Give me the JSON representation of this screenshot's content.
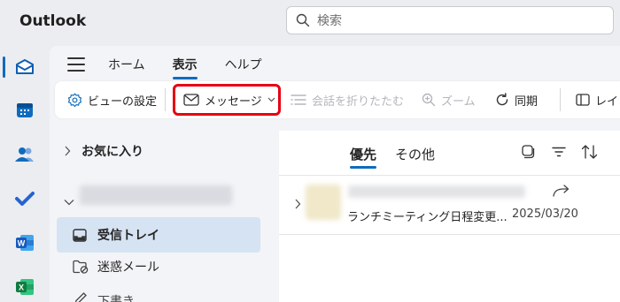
{
  "app": {
    "title": "Outlook"
  },
  "search": {
    "placeholder": "検索"
  },
  "tabs": {
    "home": "ホーム",
    "view": "表示",
    "help": "ヘルプ"
  },
  "ribbon": {
    "view_settings": "ビューの設定",
    "messages": "メッセージ",
    "collapse_conversations": "会話を折りたたむ",
    "zoom": "ズーム",
    "sync": "同期",
    "layout": "レイ"
  },
  "folders": {
    "favorites": "お気に入り",
    "inbox": "受信トレイ",
    "junk": "迷惑メール",
    "drafts": "下書き"
  },
  "mail_list": {
    "tabs": {
      "focused": "優先",
      "other": "その他"
    },
    "items": [
      {
        "subject": "ランチミーティング日程変更...",
        "date": "2025/03/20"
      }
    ]
  },
  "colors": {
    "accent": "#0f6cbd",
    "highlight": "#e60012",
    "selected_folder": "#d6e3f2"
  }
}
